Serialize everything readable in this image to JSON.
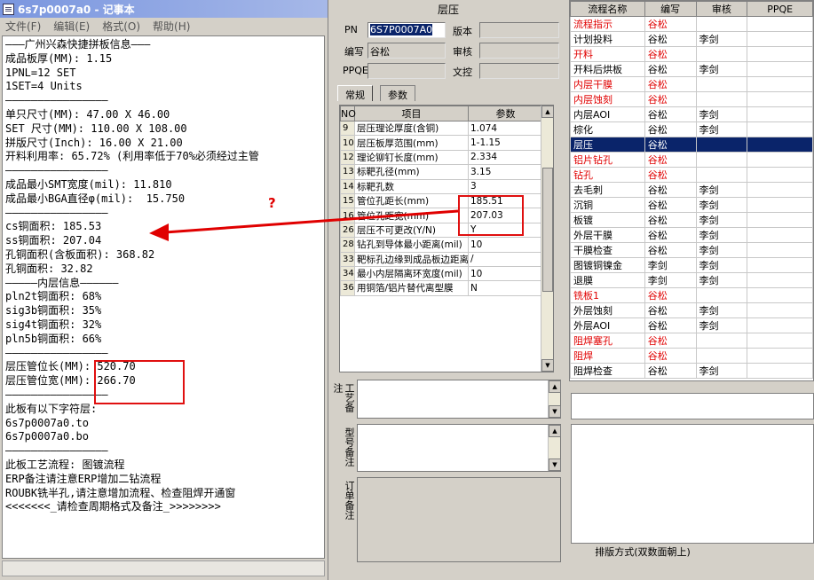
{
  "notepad": {
    "title": "6s7p0007a0 - 记事本",
    "menu": [
      "文件(F)",
      "编辑(E)",
      "格式(O)",
      "帮助(H)"
    ],
    "lines": [
      "———广州兴森快捷拼板信息———",
      "成品板厚(MM): 1.15",
      "1PNL=12 SET",
      "1SET=4 Units",
      "————————————————",
      "单只尺寸(MM): 47.00 X 46.00",
      "SET 尺寸(MM): 110.00 X 108.00",
      "拼版尺寸(Inch): 16.00 X 21.00",
      "开料利用率: 65.72% (利用率低于70%必须经过主管",
      "————————————————",
      "成品最小SMT宽度(mil): 11.810",
      "成品最小BGA直径φ(mil):  15.750",
      "————————————————",
      "cs铜面积: 185.53",
      "ss铜面积: 207.04",
      "孔铜面积(含板面积): 368.82",
      "孔铜面积: 32.82",
      "—————内层信息——————",
      "pln2t铜面积: 68%",
      "sig3b铜面积: 35%",
      "sig4t铜面积: 32%",
      "pln5b铜面积: 66%",
      "————————————————",
      "层压管位长(MM): 520.70",
      "层压管位宽(MM): 266.70",
      "————————————————",
      "此板有以下字符层:",
      "6s7p0007a0.to",
      "6s7p0007a0.bo",
      "————————————————",
      "此板工艺流程: 图镀流程",
      "ERP备注请注意ERP增加二钻流程",
      "ROUBK铣半孔,请注意增加流程、检查阻焊开通窗",
      "<<<<<<<_请检查周期格式及备注_>>>>>>>>"
    ]
  },
  "mid": {
    "title": "层压",
    "pn_label": "PN",
    "pn_value": "6S7P0007A0",
    "version_label": "版本",
    "version_value": "",
    "author_label": "编写",
    "author_value": "谷松",
    "review_label": "审核",
    "review_value": "",
    "ppqe_label": "PPQE",
    "ppqe_value": "",
    "control_label": "文控",
    "control_value": "",
    "tabs": [
      "常规",
      "参数"
    ],
    "grid_headers": [
      "NO",
      "项目",
      "参数"
    ],
    "grid_rows": [
      {
        "no": "9",
        "item": "层压理论厚度(含铜)",
        "param": "1.074"
      },
      {
        "no": "10",
        "item": "层压板厚范围(mm)",
        "param": "1-1.15"
      },
      {
        "no": "12",
        "item": "理论铆钉长度(mm)",
        "param": "2.334"
      },
      {
        "no": "13",
        "item": "标靶孔径(mm)",
        "param": "3.15"
      },
      {
        "no": "14",
        "item": "标靶孔数",
        "param": "3"
      },
      {
        "no": "15",
        "item": "管位孔距长(mm)",
        "param": "185.51"
      },
      {
        "no": "16",
        "item": "管位孔距宽(mm)",
        "param": "207.03"
      },
      {
        "no": "26",
        "item": "层压不可更改(Y/N)",
        "param": "Y"
      },
      {
        "no": "28",
        "item": "钻孔到导体最小距离(mil)",
        "param": "10"
      },
      {
        "no": "33",
        "item": "靶标孔边缘到成品板边距离",
        "param": "/"
      },
      {
        "no": "34",
        "item": "最小内层隔离环宽度(mil)",
        "param": "10"
      },
      {
        "no": "36",
        "item": "用铜箔/铝片替代离型膜",
        "param": "N"
      }
    ],
    "memo_process": "工艺备注",
    "memo_model": "型号备注",
    "memo_order": "订单备注"
  },
  "right": {
    "headers": [
      "流程名称",
      "编写",
      "审核",
      "PPQE"
    ],
    "rows": [
      {
        "name": "流程指示",
        "author": "谷松",
        "review": "",
        "red": true
      },
      {
        "name": "计划投料",
        "author": "谷松",
        "review": "李剑",
        "red": false
      },
      {
        "name": "开料",
        "author": "谷松",
        "review": "",
        "red": true
      },
      {
        "name": "开料后烘板",
        "author": "谷松",
        "review": "李剑",
        "red": false
      },
      {
        "name": "内层干膜",
        "author": "谷松",
        "review": "",
        "red": true
      },
      {
        "name": "内层蚀刻",
        "author": "谷松",
        "review": "",
        "red": true
      },
      {
        "name": "内层AOI",
        "author": "谷松",
        "review": "李剑",
        "red": false
      },
      {
        "name": "棕化",
        "author": "谷松",
        "review": "李剑",
        "red": false
      },
      {
        "name": "层压",
        "author": "谷松",
        "review": "",
        "red": true,
        "selected": true
      },
      {
        "name": "铝片钻孔",
        "author": "谷松",
        "review": "",
        "red": true
      },
      {
        "name": "钻孔",
        "author": "谷松",
        "review": "",
        "red": true
      },
      {
        "name": "去毛刺",
        "author": "谷松",
        "review": "李剑",
        "red": false
      },
      {
        "name": "沉铜",
        "author": "谷松",
        "review": "李剑",
        "red": false
      },
      {
        "name": "板镀",
        "author": "谷松",
        "review": "李剑",
        "red": false
      },
      {
        "name": "外层干膜",
        "author": "谷松",
        "review": "李剑",
        "red": false
      },
      {
        "name": "干膜检查",
        "author": "谷松",
        "review": "李剑",
        "red": false
      },
      {
        "name": "图镀铜镍金",
        "author": "李剑",
        "review": "李剑",
        "red": false
      },
      {
        "name": "退膜",
        "author": "李剑",
        "review": "李剑",
        "red": false
      },
      {
        "name": "铣板1",
        "author": "谷松",
        "review": "",
        "red": true
      },
      {
        "name": "外层蚀刻",
        "author": "谷松",
        "review": "李剑",
        "red": false
      },
      {
        "name": "外层AOI",
        "author": "谷松",
        "review": "李剑",
        "red": false
      },
      {
        "name": "阻焊塞孔",
        "author": "谷松",
        "review": "",
        "red": true
      },
      {
        "name": "阻焊",
        "author": "谷松",
        "review": "",
        "red": true
      },
      {
        "name": "阻焊检查",
        "author": "谷松",
        "review": "李剑",
        "red": false
      }
    ],
    "layout_caption": "排版方式(双数面朝上)"
  },
  "annotation": {
    "question": "?",
    "color": "#e00000"
  }
}
